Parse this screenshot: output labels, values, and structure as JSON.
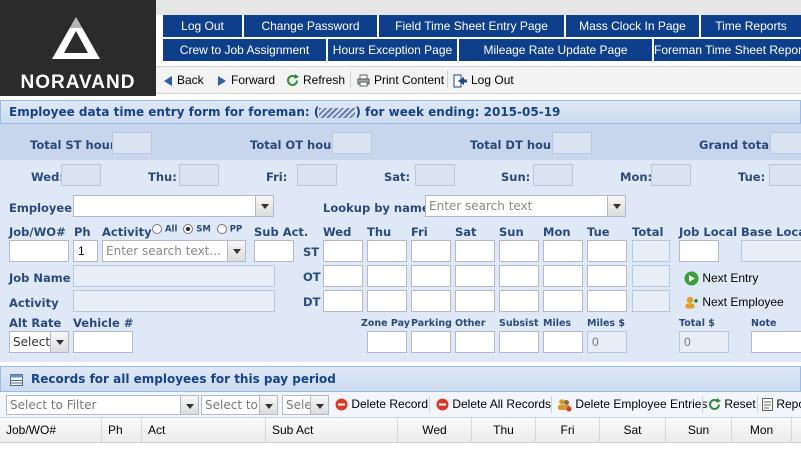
{
  "brand": {
    "logo_text": "NORAVAND"
  },
  "nav": {
    "row1": [
      "Log Out",
      "Change Password",
      "Field Time Sheet Entry Page",
      "Mass Clock In Page",
      "Time Reports"
    ],
    "row2": [
      "Crew to Job Assignment",
      "Hours Exception Page",
      "Mileage Rate Update Page",
      "Foreman Time Sheet Report"
    ]
  },
  "toolbar": {
    "back": "Back",
    "forward": "Forward",
    "refresh": "Refresh",
    "print": "Print Content",
    "logout": "Log Out"
  },
  "form": {
    "title": "Employee data time entry form for foreman: (",
    "title_mid": ") for week ending: 2015-05-19",
    "totals": {
      "st": "Total ST hour:",
      "ot": "Total OT hour:",
      "dt": "Total DT hour:",
      "grand": "Grand total:"
    },
    "days": {
      "wed": "Wed:",
      "thu": "Thu:",
      "fri": "Fri:",
      "sat": "Sat:",
      "sun": "Sun:",
      "mon": "Mon:",
      "tue": "Tue:"
    },
    "employee_label": "Employee",
    "lookup_label": "Lookup by name",
    "lookup_placeholder": "Enter search text",
    "job_label": "Job/WO#",
    "ph_label": "Ph",
    "ph_value": "1",
    "activity_label": "Activity",
    "activity_options": {
      "all": "All",
      "sm": "SM",
      "pp": "PP"
    },
    "activity_placeholder": "Enter search text...",
    "subact_label": "Sub Act.",
    "col_heads": {
      "wed": "Wed",
      "thu": "Thu",
      "fri": "Fri",
      "sat": "Sat",
      "sun": "Sun",
      "mon": "Mon",
      "tue": "Tue",
      "total": "Total",
      "job_local": "Job Local",
      "base_local": "Base Local"
    },
    "row_labels": {
      "st": "ST",
      "ot": "OT",
      "dt": "DT"
    },
    "jobname_label": "Job Name",
    "activity2_label": "Activity",
    "alt_rate_label": "Alt Rate",
    "vehicle_label": "Vehicle #",
    "alt_rate_value": "Select",
    "extras": {
      "zone_pay": "Zone Pay",
      "parking": "Parking",
      "other": "Other",
      "subsist": "Subsist",
      "miles": "Miles",
      "miles_dollar": "Miles $",
      "total_dollar": "Total $",
      "note": "Note"
    },
    "miles_dollar_value": "0",
    "total_dollar_value": "0",
    "next_entry": "Next Entry",
    "next_employee": "Next Employee"
  },
  "records": {
    "title": "Records for all employees for this pay period",
    "filter1": "Select to Filter",
    "filter2": "Select to F",
    "filter3": "Sele",
    "delete_record": "Delete Record",
    "delete_all": "Delete All Records",
    "delete_employee": "Delete Employee Entries",
    "reset": "Reset",
    "report": "Repo",
    "columns": [
      "Job/WO#",
      "Ph",
      "Act",
      "Sub Act",
      "Wed",
      "Thu",
      "Fri",
      "Sat",
      "Sun",
      "Mon"
    ]
  }
}
